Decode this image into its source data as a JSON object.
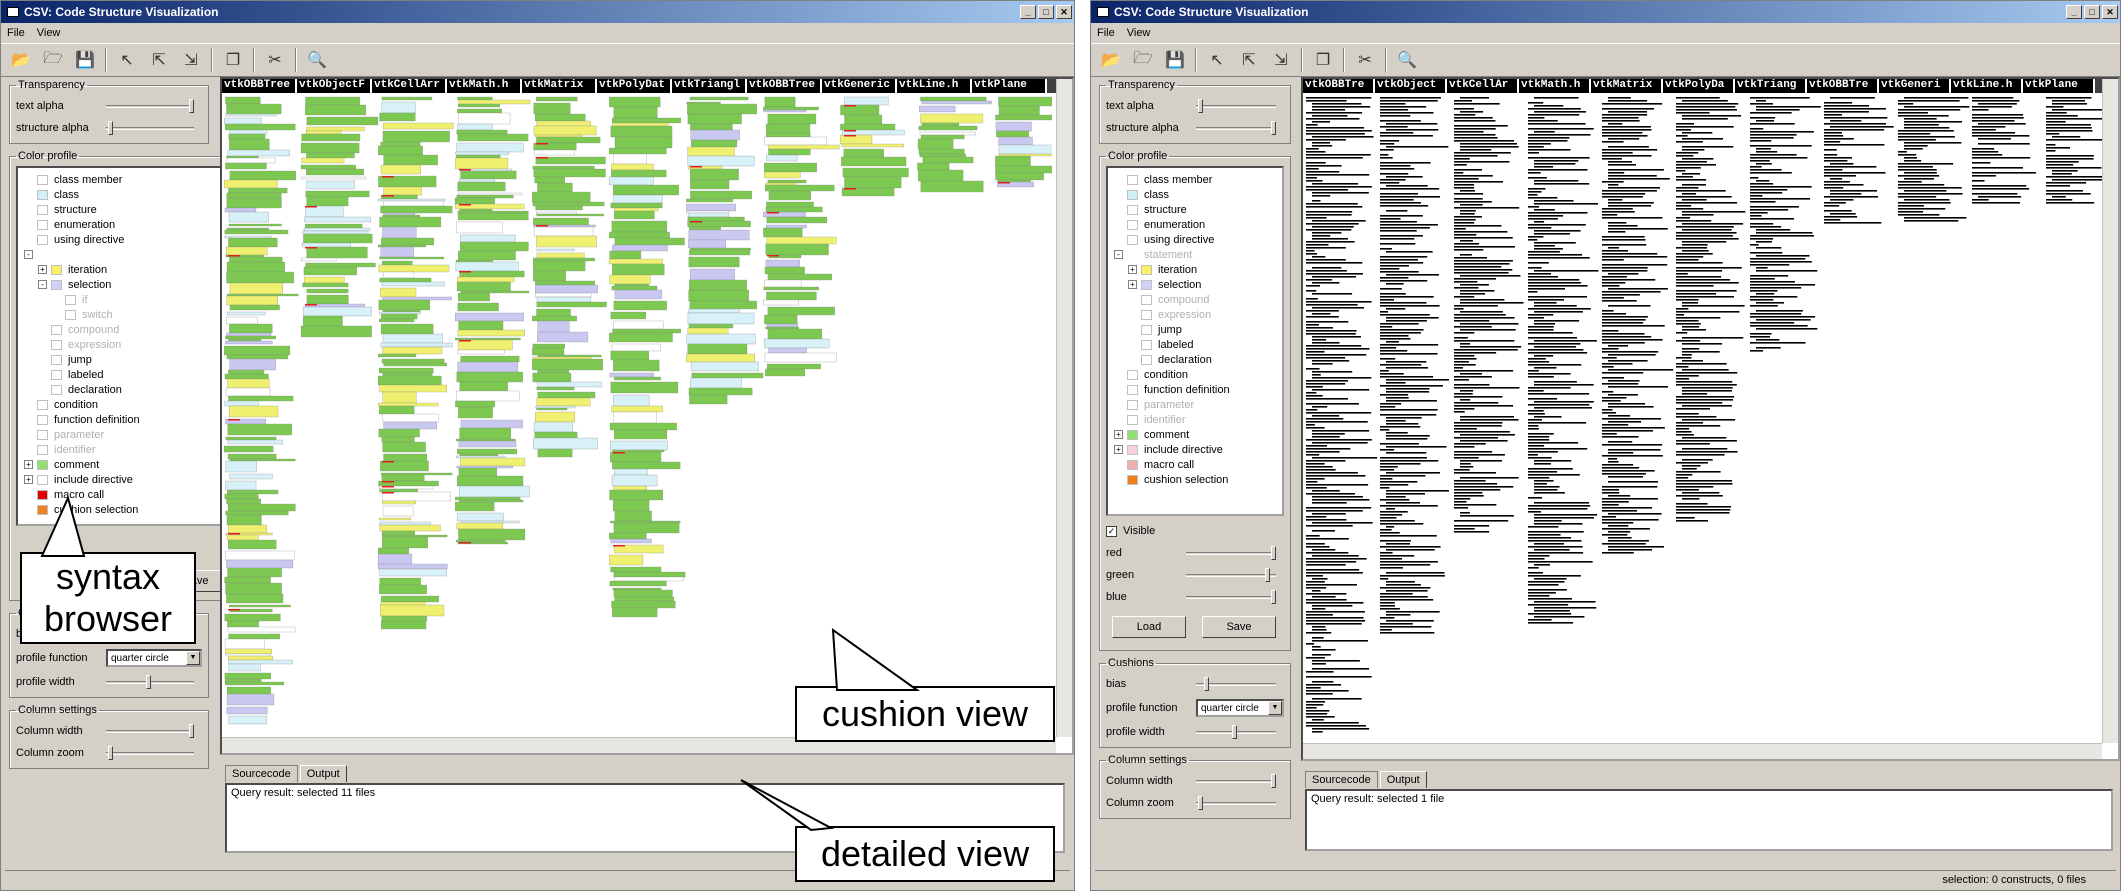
{
  "app_title": "CSV: Code Structure Visualization",
  "menus": [
    "File",
    "View"
  ],
  "toolbar_icons": [
    "open-folder-icon",
    "open-file-icon",
    "save-icon",
    "pointer-icon",
    "select-icon",
    "select-add-icon",
    "copy-icon",
    "cut-icon",
    "zoom-icon"
  ],
  "transparency": {
    "legend": "Transparency",
    "text_alpha": "text alpha",
    "structure_alpha": "structure alpha"
  },
  "color_profile": {
    "legend": "Color profile",
    "left_items": [
      {
        "label": "class member",
        "color": "#ffffff",
        "level": 0,
        "grey": false,
        "expander": ""
      },
      {
        "label": "class",
        "color": "#d0f0f8",
        "level": 0,
        "grey": false,
        "expander": ""
      },
      {
        "label": "structure",
        "color": "#ffffff",
        "level": 0,
        "grey": false,
        "expander": ""
      },
      {
        "label": "enumeration",
        "color": "#ffffff",
        "level": 0,
        "grey": false,
        "expander": ""
      },
      {
        "label": "using directive",
        "color": "#ffffff",
        "level": 0,
        "grey": false,
        "expander": ""
      },
      {
        "label": "",
        "color": "",
        "level": 0,
        "grey": false,
        "expander": "-"
      },
      {
        "label": "iteration",
        "color": "#f8f068",
        "level": 1,
        "grey": false,
        "expander": "+"
      },
      {
        "label": "selection",
        "color": "#d0d0f8",
        "level": 1,
        "grey": false,
        "expander": "-"
      },
      {
        "label": "if",
        "color": "#ffffff",
        "level": 2,
        "grey": true,
        "expander": ""
      },
      {
        "label": "switch",
        "color": "#ffffff",
        "level": 2,
        "grey": true,
        "expander": ""
      },
      {
        "label": "compound",
        "color": "#ffffff",
        "level": 1,
        "grey": true,
        "expander": ""
      },
      {
        "label": "expression",
        "color": "#ffffff",
        "level": 1,
        "grey": true,
        "expander": ""
      },
      {
        "label": "jump",
        "color": "#ffffff",
        "level": 1,
        "grey": false,
        "expander": ""
      },
      {
        "label": "labeled",
        "color": "#ffffff",
        "level": 1,
        "grey": false,
        "expander": ""
      },
      {
        "label": "declaration",
        "color": "#ffffff",
        "level": 1,
        "grey": false,
        "expander": ""
      },
      {
        "label": "condition",
        "color": "#ffffff",
        "level": 0,
        "grey": false,
        "expander": ""
      },
      {
        "label": "function definition",
        "color": "#ffffff",
        "level": 0,
        "grey": false,
        "expander": ""
      },
      {
        "label": "parameter",
        "color": "#ffffff",
        "level": 0,
        "grey": true,
        "expander": ""
      },
      {
        "label": "identifier",
        "color": "#ffffff",
        "level": 0,
        "grey": true,
        "expander": ""
      },
      {
        "label": "comment",
        "color": "#90e070",
        "level": 0,
        "grey": false,
        "expander": "+"
      },
      {
        "label": "include directive",
        "color": "#ffffff",
        "level": 0,
        "grey": false,
        "expander": "+"
      },
      {
        "label": "macro call",
        "color": "#e00000",
        "level": 0,
        "grey": false,
        "expander": ""
      },
      {
        "label": "cushion selection",
        "color": "#f08020",
        "level": 0,
        "grey": false,
        "expander": ""
      }
    ],
    "right_items": [
      {
        "label": "class member",
        "color": "#ffffff",
        "level": 0,
        "grey": false,
        "expander": ""
      },
      {
        "label": "class",
        "color": "#d0f0f8",
        "level": 0,
        "grey": false,
        "expander": ""
      },
      {
        "label": "structure",
        "color": "#ffffff",
        "level": 0,
        "grey": false,
        "expander": ""
      },
      {
        "label": "enumeration",
        "color": "#ffffff",
        "level": 0,
        "grey": false,
        "expander": ""
      },
      {
        "label": "using directive",
        "color": "#ffffff",
        "level": 0,
        "grey": false,
        "expander": ""
      },
      {
        "label": "statement",
        "color": "",
        "level": 0,
        "grey": true,
        "expander": "-"
      },
      {
        "label": "iteration",
        "color": "#f8f068",
        "level": 1,
        "grey": false,
        "expander": "+"
      },
      {
        "label": "selection",
        "color": "#d0d0f8",
        "level": 1,
        "grey": false,
        "expander": "+"
      },
      {
        "label": "compound",
        "color": "#ffffff",
        "level": 1,
        "grey": true,
        "expander": ""
      },
      {
        "label": "expression",
        "color": "#ffffff",
        "level": 1,
        "grey": true,
        "expander": ""
      },
      {
        "label": "jump",
        "color": "#ffffff",
        "level": 1,
        "grey": false,
        "expander": ""
      },
      {
        "label": "labeled",
        "color": "#ffffff",
        "level": 1,
        "grey": false,
        "expander": ""
      },
      {
        "label": "declaration",
        "color": "#ffffff",
        "level": 1,
        "grey": false,
        "expander": ""
      },
      {
        "label": "condition",
        "color": "#ffffff",
        "level": 0,
        "grey": false,
        "expander": ""
      },
      {
        "label": "function definition",
        "color": "#ffffff",
        "level": 0,
        "grey": false,
        "expander": ""
      },
      {
        "label": "parameter",
        "color": "#ffffff",
        "level": 0,
        "grey": true,
        "expander": ""
      },
      {
        "label": "identifier",
        "color": "#ffffff",
        "level": 0,
        "grey": true,
        "expander": ""
      },
      {
        "label": "comment",
        "color": "#90e070",
        "level": 0,
        "grey": false,
        "expander": "+"
      },
      {
        "label": "include directive",
        "color": "#f8d0e0",
        "level": 0,
        "grey": false,
        "expander": "+"
      },
      {
        "label": "macro call",
        "color": "#f0b0b0",
        "level": 0,
        "grey": false,
        "expander": ""
      },
      {
        "label": "cushion selection",
        "color": "#f08020",
        "level": 0,
        "grey": false,
        "expander": ""
      }
    ]
  },
  "visible": {
    "label": "Visible",
    "red": "red",
    "green": "green",
    "blue": "blue"
  },
  "buttons": {
    "load": "Load",
    "save": "Save"
  },
  "cushions": {
    "legend": "Cushions",
    "bias": "bias",
    "profile_function": "profile function",
    "profile_value": "quarter circle",
    "profile_width": "profile width"
  },
  "column_settings": {
    "legend": "Column settings",
    "width": "Column width",
    "zoom": "Column zoom"
  },
  "columns_left": [
    "vtkOBBTree",
    "vtkObjectF",
    "vtkCellArr",
    "vtkMath.h",
    "vtkMatrix",
    "vtkPolyDat",
    "vtkTriangl",
    "vtkOBBTree",
    "vtkGeneric",
    "vtkLine.h",
    "vtkPlane"
  ],
  "columns_right": [
    "vtkOBBTre",
    "vtkObject",
    "vtkCellAr",
    "vtkMath.h",
    "vtkMatrix",
    "vtkPolyDa",
    "vtkTriang",
    "vtkOBBTre",
    "vtkGeneri",
    "vtkLine.h",
    "vtkPlane"
  ],
  "tabs": [
    "Sourcecode",
    "Output"
  ],
  "output_left": "Query result: selected 11 files",
  "output_right": "Query result: selected 1 file",
  "status_right": "selection: 0 constructs, 0 files",
  "callouts": {
    "syntax": "syntax browser",
    "cushion": "cushion view",
    "detailed": "detailed view"
  },
  "colors": {
    "comment": "#7dc850",
    "class": "#d8f0f8",
    "iteration": "#f0f070",
    "selection": "#c8c8f0",
    "macro": "#e02020"
  }
}
